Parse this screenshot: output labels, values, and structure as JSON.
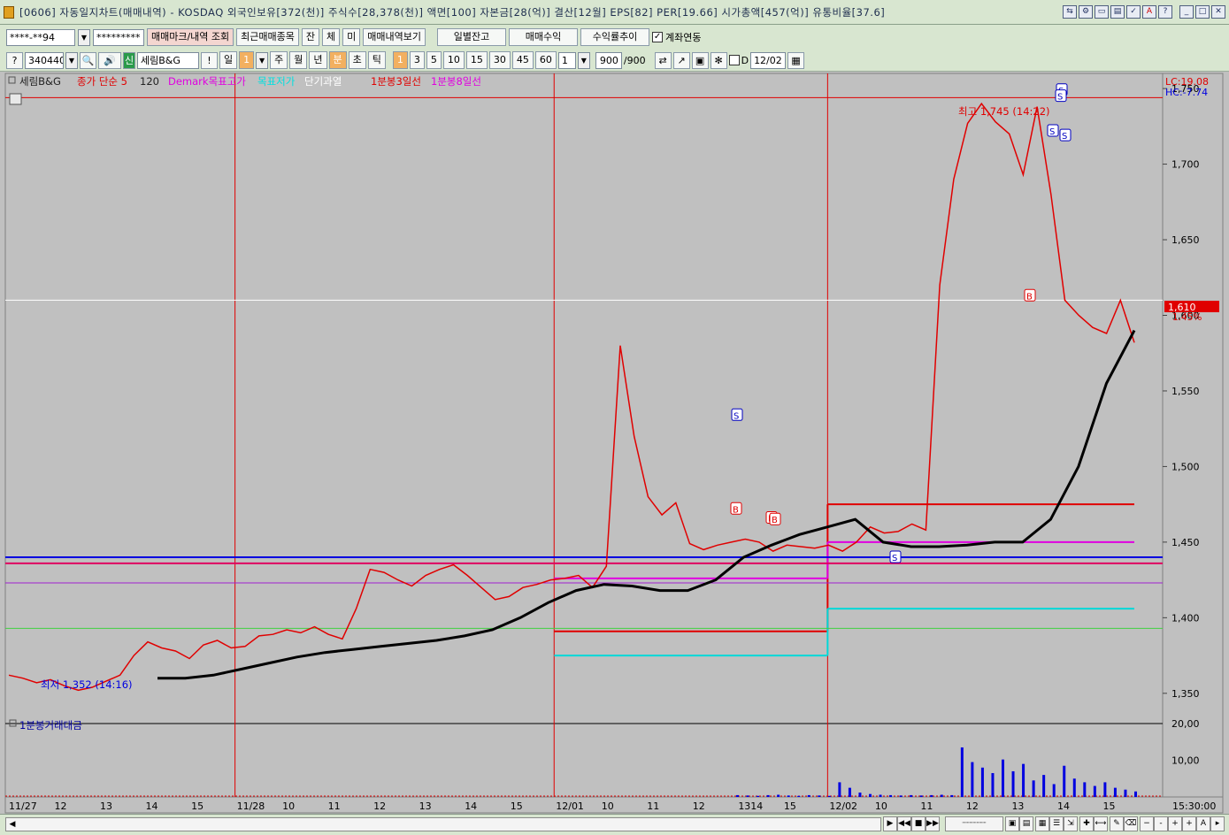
{
  "window": {
    "title": "[0606] 자동일지차트(매매내역) - KOSDAQ 외국인보유[372(천)] 주식수[28,378(천)] 액면[100] 자본금[28(억)] 결산[12월] EPS[82] PER[19.66] 시가총액[457(억)] 유통비율[37.6]"
  },
  "toolbar1": {
    "account": "****-**94",
    "password": "*********",
    "btn_trade_mark": "매매마크/내역 조회",
    "btn_recent": "최근매매종목",
    "btn_jan": "잔",
    "btn_che": "체",
    "btn_mi": "미",
    "btn_trade_view": "매매내역보기",
    "btn_daily_balance": "일별잔고",
    "btn_trade_profit": "매매수익",
    "btn_return_trend": "수익률추이",
    "chk_account_link": "계좌연동"
  },
  "toolbar2": {
    "code": "340440",
    "shin": "신",
    "name": "세림B&G",
    "period_day": "일",
    "period_day_n": "1",
    "period_week": "주",
    "period_month": "월",
    "period_year": "년",
    "period_min": "분",
    "period_sec": "초",
    "period_tick": "틱",
    "intervals": [
      "1",
      "3",
      "5",
      "10",
      "15",
      "30",
      "45",
      "60"
    ],
    "interval_n": "1",
    "count": "900",
    "count_total": "/900",
    "d_label": "D",
    "date": "12/02"
  },
  "legend": {
    "name": "세림B&G",
    "ma": "종가 단순 5",
    "ma_period": "120",
    "demark_high": "Demark목표고가",
    "target_price": "목표저가",
    "short_over": "단기과열",
    "m3_line": "1분봉3일선",
    "m8_line": "1분봉8일선",
    "lc": "LC:19.08",
    "hc": "HC:-7.74",
    "current_price": "1,610",
    "current_pct": "1.45%",
    "high_label": "최고 1,745 (14:22)",
    "low_label": "최저 1,352 (14:16)",
    "volume_title": "1분봉거래대금"
  },
  "colors": {
    "price": "#e00000",
    "ma120": "#000000",
    "demark": "#e000e0",
    "target_low": "#00d8d8",
    "m3": "#e00000",
    "m8": "#e000e0",
    "blue_line": "#0000e0",
    "panel_bg": "#c0c0c0"
  },
  "bottom_time": "15:30:00",
  "chart_data": [
    {
      "type": "line",
      "title": "세림B&G",
      "x": [
        "11/27",
        "12",
        "13",
        "14",
        "15",
        "11/28",
        "10",
        "11",
        "12",
        "13",
        "14",
        "15",
        "12/01",
        "10",
        "11",
        "12",
        "1314",
        "15",
        "12/02",
        "10",
        "11",
        "12",
        "13",
        "14",
        "15"
      ],
      "ylim": [
        1330,
        1760
      ],
      "y_ticks": [
        1350,
        1400,
        1450,
        1500,
        1550,
        1600,
        1650,
        1700,
        1750
      ],
      "y_tick_labels": [
        "1,350",
        "1,400",
        "1,450",
        "1,500",
        "1,550",
        "1,600",
        "1,650",
        "1,700",
        "1,750"
      ],
      "series": [
        {
          "name": "종가",
          "values": [
            1362,
            1360,
            1357,
            1359,
            1355,
            1352,
            1354,
            1358,
            1362,
            1375,
            1384,
            1380,
            1378,
            1373,
            1382,
            1385,
            1380,
            1381,
            1388,
            1389,
            1392,
            1390,
            1394,
            1389,
            1386,
            1406,
            1432,
            1430,
            1425,
            1421,
            1428,
            1432,
            1435,
            1428,
            1420,
            1412,
            1414,
            1420,
            1422,
            1425,
            1426,
            1428,
            1420,
            1434,
            1580,
            1520,
            1480,
            1468,
            1476,
            1449,
            1445,
            1448,
            1450,
            1452,
            1450,
            1444,
            1448,
            1447,
            1446,
            1448,
            1444,
            1450,
            1460,
            1456,
            1457,
            1462,
            1458,
            1620,
            1690,
            1727,
            1740,
            1728,
            1720,
            1693,
            1738,
            1680,
            1610,
            1600,
            1592,
            1588,
            1610,
            1582
          ]
        },
        {
          "name": "종가 단순 5 120",
          "values": [
            1360,
            1360,
            1362,
            1366,
            1370,
            1374,
            1377,
            1379,
            1381,
            1383,
            1385,
            1388,
            1392,
            1400,
            1410,
            1418,
            1422,
            1421,
            1418,
            1418,
            1425,
            1440,
            1448,
            1455,
            1460,
            1465,
            1450,
            1447,
            1447,
            1448,
            1450,
            1450,
            1465,
            1500,
            1555,
            1590
          ]
        }
      ],
      "h_lines": [
        {
          "name": "1분봉3일선",
          "values": [
            1391,
            1475
          ]
        },
        {
          "name": "1분봉8일선",
          "values": [
            1426,
            1450
          ]
        },
        {
          "name": "목표저가",
          "values": [
            1375,
            1406
          ]
        },
        {
          "name": "blue",
          "value": 1440
        },
        {
          "name": "crimson",
          "value": 1436
        },
        {
          "name": "purple",
          "value": 1423
        },
        {
          "name": "green",
          "value": 1393
        },
        {
          "name": "red_top",
          "value": 1744
        },
        {
          "name": "white_current",
          "value": 1610
        }
      ],
      "markers": [
        {
          "label": "S",
          "value": 1534
        },
        {
          "label": "B",
          "value": 1472
        },
        {
          "label": "B",
          "value": 1466
        },
        {
          "label": "B",
          "value": 1465
        },
        {
          "label": "S",
          "value": 1440
        },
        {
          "label": "B",
          "value": 1613
        },
        {
          "label": "S",
          "value": 1722
        },
        {
          "label": "S",
          "value": 1719
        },
        {
          "label": "S",
          "value": 1749
        },
        {
          "label": "S",
          "value": 1745
        }
      ]
    },
    {
      "type": "bar",
      "title": "1분봉거래대금",
      "ylim": [
        0,
        20
      ],
      "y_ticks": [
        10,
        20
      ],
      "y_tick_labels": [
        "10,00",
        "20,00"
      ],
      "series": [
        {
          "name": "1분봉거래대금",
          "values": [
            0.5,
            0.4,
            0.3,
            0.5,
            0.6,
            0.4,
            0.3,
            0.5,
            0.4,
            0.3,
            4.0,
            2.5,
            1.2,
            0.8,
            0.6,
            0.5,
            0.4,
            0.5,
            0.4,
            0.5,
            0.6,
            0.5,
            13.5,
            9.5,
            8.0,
            6.5,
            10.2,
            7.0,
            9.0,
            4.5,
            6.0,
            3.5,
            8.5,
            5.0,
            4.0,
            3.0,
            4.0,
            2.5,
            2.0,
            1.5
          ]
        }
      ]
    }
  ]
}
